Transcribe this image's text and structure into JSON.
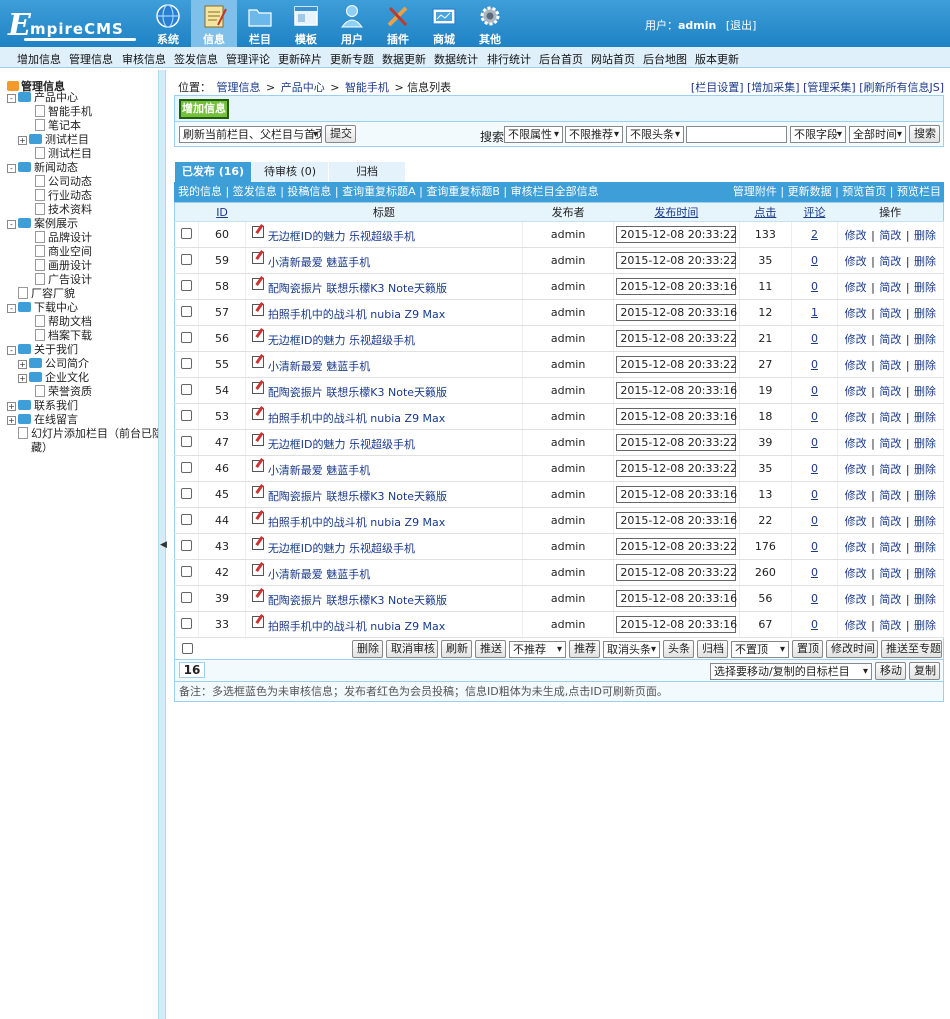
{
  "header": {
    "logo_text": "EmpireCMS",
    "nav": [
      {
        "label": "系统",
        "icon": "globe-icon"
      },
      {
        "label": "信息",
        "icon": "notepad-icon"
      },
      {
        "label": "栏目",
        "icon": "folder-icon"
      },
      {
        "label": "模板",
        "icon": "window-icon"
      },
      {
        "label": "用户",
        "icon": "user-icon"
      },
      {
        "label": "插件",
        "icon": "tools-icon"
      },
      {
        "label": "商城",
        "icon": "shop-icon"
      },
      {
        "label": "其他",
        "icon": "gear-icon"
      }
    ],
    "user_prefix": "用户：",
    "username": "admin",
    "logout": "[退出]"
  },
  "submenu": [
    "增加信息",
    "管理信息",
    "审核信息",
    "签发信息",
    "管理评论",
    "更新碎片",
    "更新专题",
    "数据更新",
    "数据统计",
    "排行统计",
    "后台首页",
    "网站首页",
    "后台地图",
    "版本更新"
  ],
  "tree": {
    "root": "管理信息",
    "nodes": [
      "产品中心",
      "智能手机",
      "笔记本",
      "测试栏目",
      "测试栏目",
      "新闻动态",
      "公司动态",
      "行业动态",
      "技术资料",
      "案例展示",
      "品牌设计",
      "商业空间",
      "画册设计",
      "广告设计",
      "厂容厂貌",
      "下载中心",
      "帮助文档",
      "档案下载",
      "关于我们",
      "公司简介",
      "企业文化",
      "荣誉资质",
      "联系我们",
      "在线留言",
      "幻灯片添加栏目（前台已隐",
      "藏）"
    ]
  },
  "location": {
    "prefix": "位置：",
    "crumbs": [
      "管理信息",
      ">",
      "产品中心",
      ">",
      "智能手机",
      ">",
      "信息列表"
    ]
  },
  "toplinks": [
    "[栏目设置]",
    "[增加采集]",
    "[管理采集]",
    "[刷新所有信息JS]"
  ],
  "add_button": "增加信息",
  "filter": {
    "refresh_select": "刷新当前栏目、父栏目与首页",
    "submit": "提交",
    "search_label": "搜索:",
    "attr": "不限属性",
    "recommend": "不限推荐",
    "headline": "不限头条",
    "field": "不限字段",
    "time": "全部时间",
    "search_btn": "搜索"
  },
  "tabs": [
    "已发布 (16)",
    "待审核 (0)",
    "归档"
  ],
  "tblbar": {
    "left": [
      "我的信息",
      "签发信息",
      "投稿信息",
      "查询重复标题A",
      "查询重复标题B",
      "审核栏目全部信息"
    ],
    "right": [
      "管理附件",
      "更新数据",
      "预览首页",
      "预览栏目"
    ]
  },
  "columns": [
    "ID",
    "标题",
    "发布者",
    "发布时间",
    "点击",
    "评论",
    "操作"
  ],
  "ops": [
    "修改",
    "简改",
    "删除"
  ],
  "rows": [
    {
      "id": "60",
      "title": "无边框ID的魅力 乐视超级手机",
      "author": "admin",
      "time": "2015-12-08 20:33:22",
      "hits": "133",
      "comments": "2"
    },
    {
      "id": "59",
      "title": "小清新最爱 魅蓝手机",
      "author": "admin",
      "time": "2015-12-08 20:33:22",
      "hits": "35",
      "comments": "0"
    },
    {
      "id": "58",
      "title": "配陶瓷振片 联想乐檬K3 Note天籁版",
      "author": "admin",
      "time": "2015-12-08 20:33:16",
      "hits": "11",
      "comments": "0"
    },
    {
      "id": "57",
      "title": "拍照手机中的战斗机 nubia Z9 Max",
      "author": "admin",
      "time": "2015-12-08 20:33:16",
      "hits": "12",
      "comments": "1"
    },
    {
      "id": "56",
      "title": "无边框ID的魅力 乐视超级手机",
      "author": "admin",
      "time": "2015-12-08 20:33:22",
      "hits": "21",
      "comments": "0"
    },
    {
      "id": "55",
      "title": "小清新最爱 魅蓝手机",
      "author": "admin",
      "time": "2015-12-08 20:33:22",
      "hits": "27",
      "comments": "0"
    },
    {
      "id": "54",
      "title": "配陶瓷振片 联想乐檬K3 Note天籁版",
      "author": "admin",
      "time": "2015-12-08 20:33:16",
      "hits": "19",
      "comments": "0"
    },
    {
      "id": "53",
      "title": "拍照手机中的战斗机 nubia Z9 Max",
      "author": "admin",
      "time": "2015-12-08 20:33:16",
      "hits": "18",
      "comments": "0"
    },
    {
      "id": "47",
      "title": "无边框ID的魅力 乐视超级手机",
      "author": "admin",
      "time": "2015-12-08 20:33:22",
      "hits": "39",
      "comments": "0"
    },
    {
      "id": "46",
      "title": "小清新最爱 魅蓝手机",
      "author": "admin",
      "time": "2015-12-08 20:33:22",
      "hits": "35",
      "comments": "0"
    },
    {
      "id": "45",
      "title": "配陶瓷振片 联想乐檬K3 Note天籁版",
      "author": "admin",
      "time": "2015-12-08 20:33:16",
      "hits": "13",
      "comments": "0"
    },
    {
      "id": "44",
      "title": "拍照手机中的战斗机 nubia Z9 Max",
      "author": "admin",
      "time": "2015-12-08 20:33:16",
      "hits": "22",
      "comments": "0"
    },
    {
      "id": "43",
      "title": "无边框ID的魅力 乐视超级手机",
      "author": "admin",
      "time": "2015-12-08 20:33:22",
      "hits": "176",
      "comments": "0"
    },
    {
      "id": "42",
      "title": "小清新最爱 魅蓝手机",
      "author": "admin",
      "time": "2015-12-08 20:33:22",
      "hits": "260",
      "comments": "0"
    },
    {
      "id": "39",
      "title": "配陶瓷振片 联想乐檬K3 Note天籁版",
      "author": "admin",
      "time": "2015-12-08 20:33:16",
      "hits": "56",
      "comments": "0"
    },
    {
      "id": "33",
      "title": "拍照手机中的战斗机 nubia Z9 Max",
      "author": "admin",
      "time": "2015-12-08 20:33:16",
      "hits": "67",
      "comments": "0"
    }
  ],
  "actions": {
    "delete": "删除",
    "cancel_check": "取消审核",
    "refresh": "刷新",
    "push": "推送",
    "norecommend": "不推荐",
    "recommend": "推荐",
    "cancel_headline": "取消头条",
    "headline": "头条",
    "archive": "归档",
    "no_top": "不置顶",
    "set_top": "置顶",
    "modify_time": "修改时间",
    "push_topic": "推送至专题"
  },
  "paging": {
    "count": "16",
    "target_select": "选择要移动/复制的目标栏目",
    "move": "移动",
    "copy": "复制"
  },
  "note": "备注：多选框蓝色为未审核信息；发布者红色为会员投稿；信息ID粗体为未生成,点击ID可刷新页面。"
}
